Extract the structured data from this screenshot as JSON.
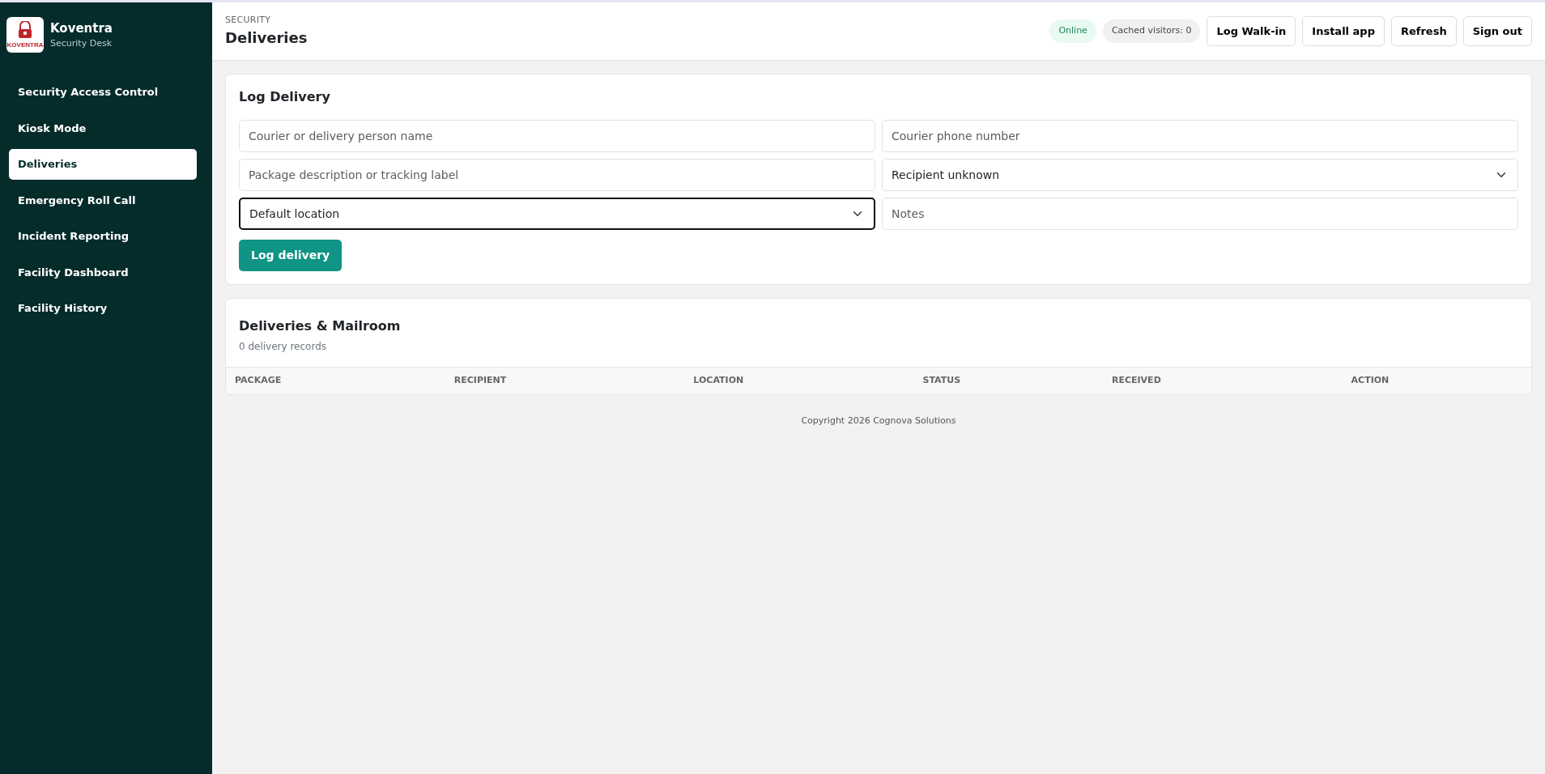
{
  "sidebar": {
    "brand": "Koventra",
    "subtitle": "Security Desk",
    "logo_text": "KOVENTRA",
    "items": [
      {
        "label": "Security Access Control",
        "selected": false
      },
      {
        "label": "Kiosk Mode",
        "selected": false
      },
      {
        "label": "Deliveries",
        "selected": true
      },
      {
        "label": "Emergency Roll Call",
        "selected": false
      },
      {
        "label": "Incident Reporting",
        "selected": false
      },
      {
        "label": "Facility Dashboard",
        "selected": false
      },
      {
        "label": "Facility History",
        "selected": false
      }
    ]
  },
  "header": {
    "eyebrow": "SECURITY",
    "title": "Deliveries",
    "status": "Online",
    "cached": "Cached visitors: 0",
    "buttons": [
      "Log Walk-in",
      "Install app",
      "Refresh",
      "Sign out"
    ]
  },
  "form": {
    "title": "Log Delivery",
    "fields": [
      {
        "kind": "input",
        "placeholder": "Courier or delivery person name",
        "focused": false
      },
      {
        "kind": "input",
        "placeholder": "Courier phone number",
        "focused": false
      },
      {
        "kind": "input",
        "placeholder": "Package description or tracking label",
        "focused": false
      },
      {
        "kind": "select",
        "value": "Recipient unknown",
        "focused": false
      },
      {
        "kind": "select",
        "value": "Default location",
        "focused": true
      },
      {
        "kind": "input",
        "placeholder": "Notes",
        "focused": false
      }
    ],
    "submit": "Log delivery"
  },
  "table": {
    "title": "Deliveries & Mailroom",
    "count": "0 delivery records",
    "columns": [
      "PACKAGE",
      "RECIPIENT",
      "LOCATION",
      "STATUS",
      "RECEIVED",
      "ACTION"
    ]
  },
  "footer": "Copyright 2026 Cognova Solutions"
}
